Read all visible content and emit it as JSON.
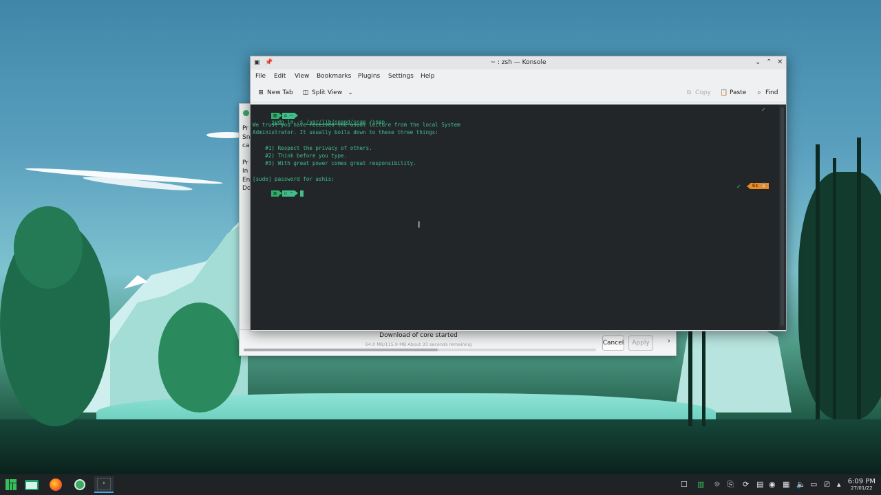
{
  "konsole": {
    "title": "~ : zsh — Konsole",
    "menu": [
      "File",
      "Edit",
      "View",
      "Bookmarks",
      "Plugins",
      "Settings",
      "Help"
    ],
    "toolbar": {
      "new_tab": "New Tab",
      "split_view": "Split View",
      "copy": "Copy",
      "paste": "Paste",
      "find": "Find"
    },
    "terminal": {
      "prompt_dir": "~",
      "cmd_sudo": "sudo",
      "cmd_ln": " ln -s ",
      "cmd_src": "/var/lib/snapd/snap",
      "cmd_dst": " /snap",
      "lecture_1": "We trust you have received the usual lecture from the local System",
      "lecture_2": "Administrator. It usually boils down to these three things:",
      "rule_1": "    #1) Respect the privacy of others.",
      "rule_2": "    #2) Think before you type.",
      "rule_3": "    #3) With great power comes great responsibility.",
      "sudo_prompt": "[sudo] password for ashis:",
      "timer": "6s",
      "check": "✓"
    }
  },
  "back_dialog": {
    "partial_lines": [
      "Pr",
      "Sn",
      "ca",
      "Pr",
      "In",
      "En",
      "Do"
    ],
    "download_title": "Download of core started",
    "download_detail": "64.0 MB/115.9 MB  About 33 seconds remaining",
    "progress": 0.55,
    "cancel": "Cancel",
    "apply": "Apply"
  },
  "taskbar": {
    "time": "6:09 PM",
    "date": "27/01/22"
  }
}
